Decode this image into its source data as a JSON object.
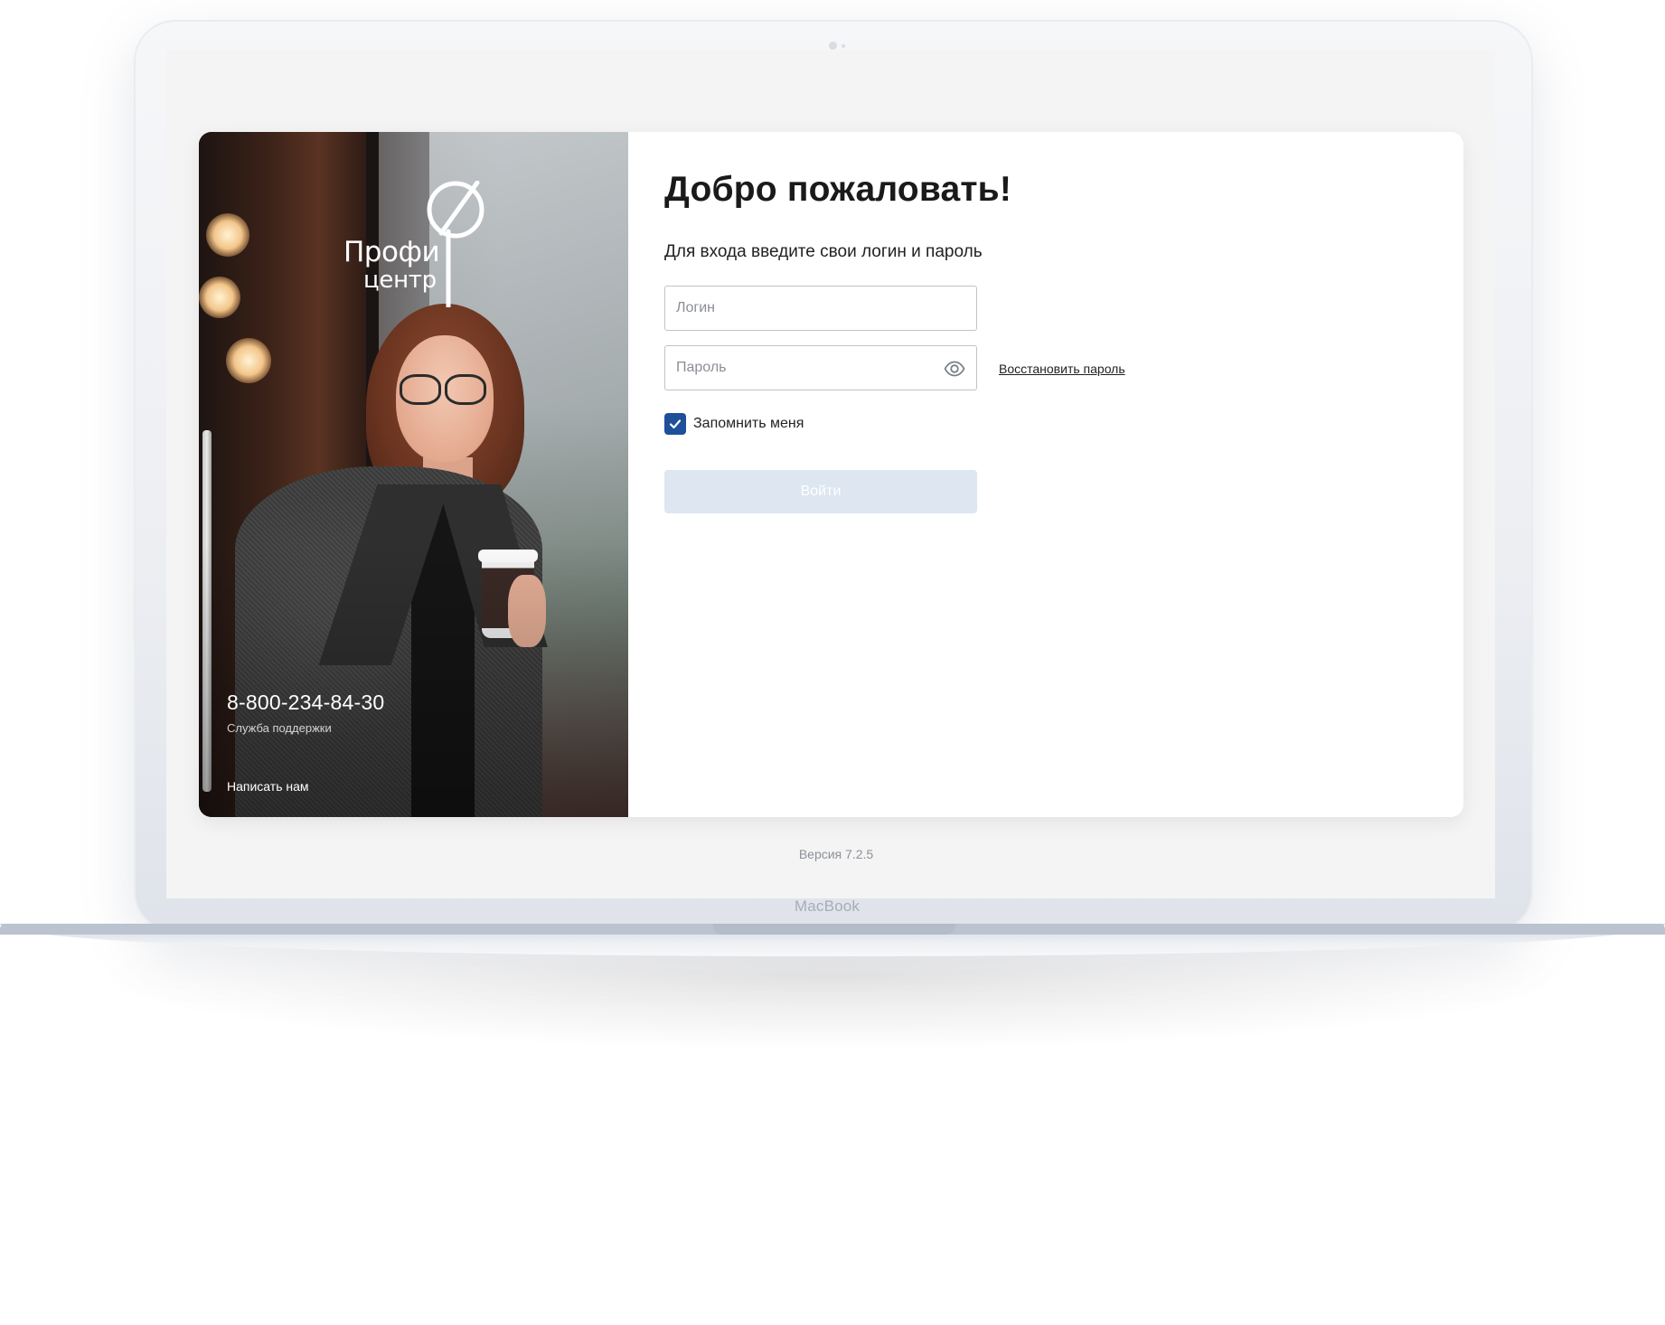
{
  "device": {
    "label": "MacBook"
  },
  "brand": {
    "line1": "Профи",
    "line2": "центр"
  },
  "support": {
    "phone": "8-800-234-84-30",
    "label": "Служба поддержки",
    "write_us": "Написать нам"
  },
  "form": {
    "title": "Добро пожаловать!",
    "instruction": "Для входа введите свои логин и пароль",
    "login": {
      "placeholder": "Логин",
      "value": ""
    },
    "password": {
      "placeholder": "Пароль",
      "value": "",
      "toggle_icon": "eye-icon"
    },
    "restore_link": "Восстановить пароль",
    "remember": {
      "label": "Запомнить меня",
      "checked": true
    },
    "submit_label": "Войти"
  },
  "footer": {
    "version": "Версия 7.2.5"
  },
  "colors": {
    "accent": "#1e4f9a",
    "button_disabled": "#dde6f1",
    "screen_bg": "#f4f4f4"
  }
}
